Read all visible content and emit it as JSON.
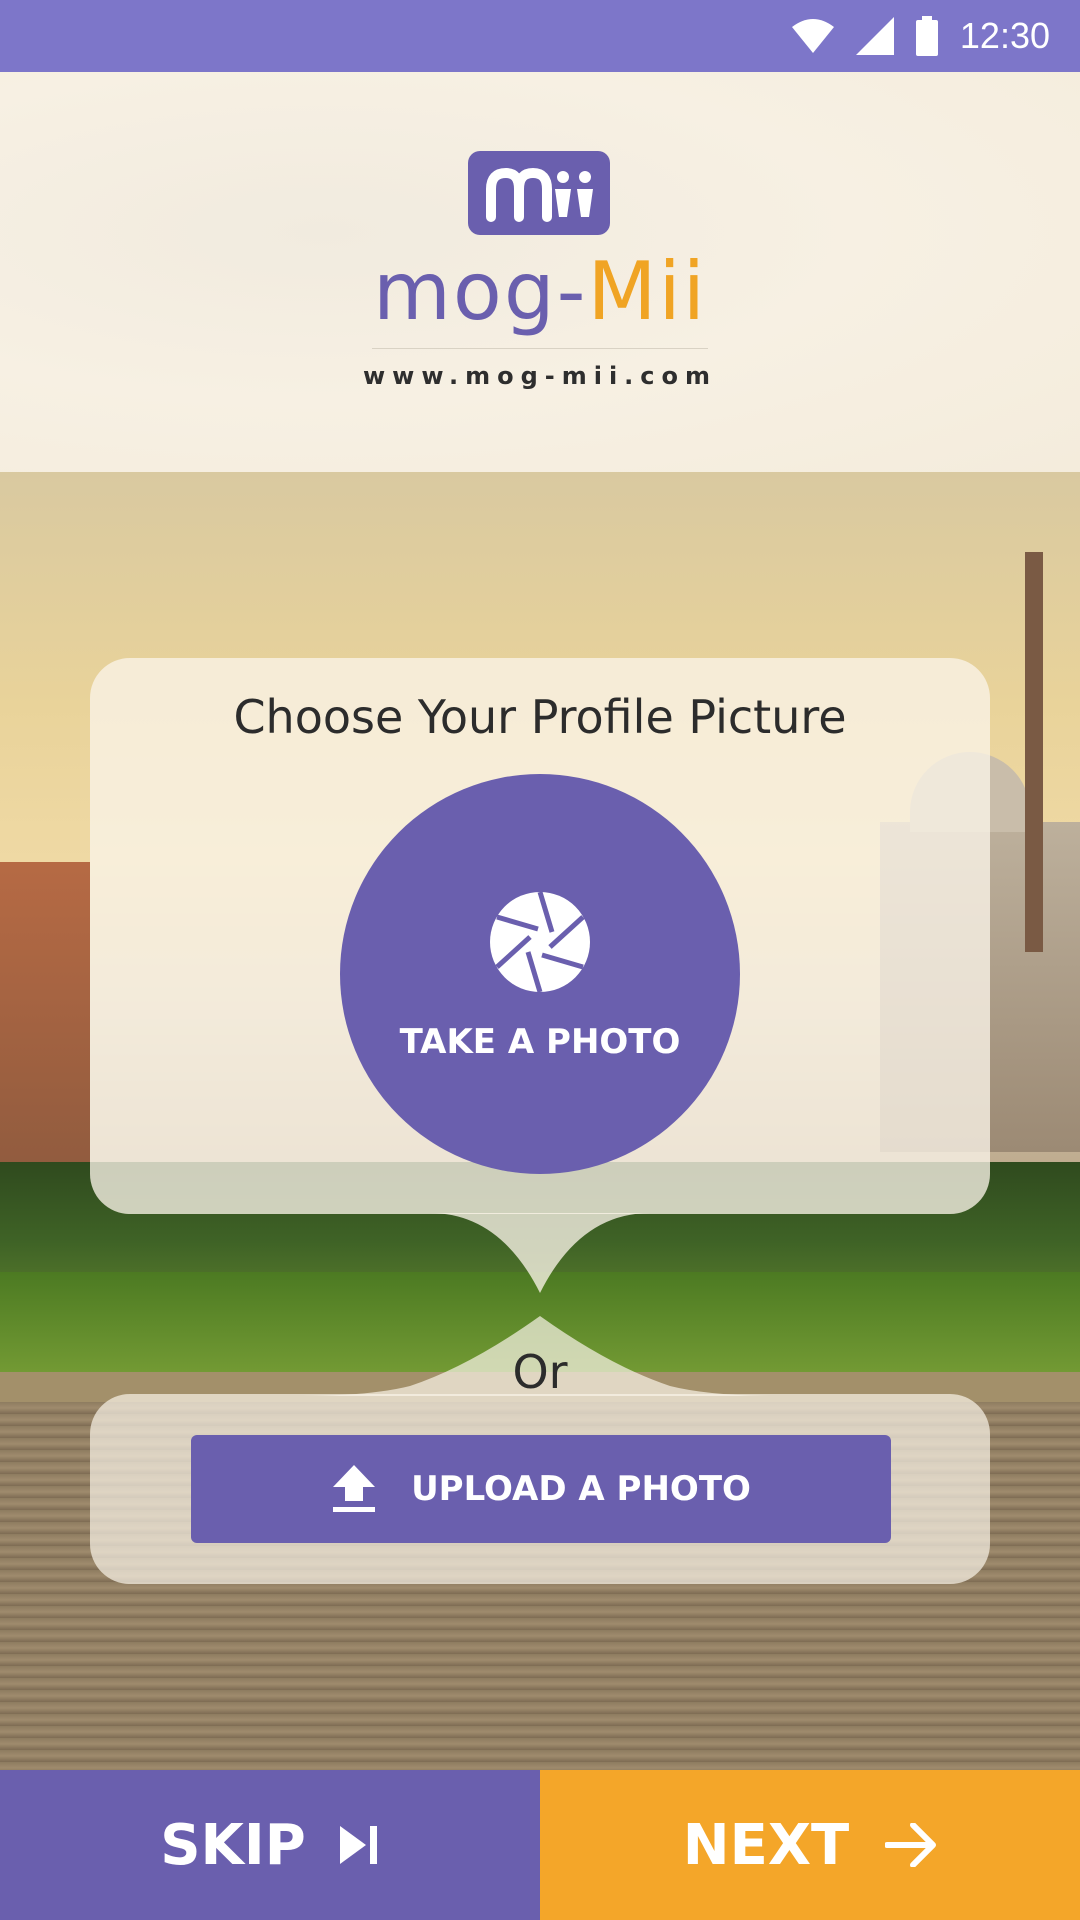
{
  "status_bar": {
    "time": "12:30",
    "icons": [
      "wifi-icon",
      "signal-icon",
      "battery-icon"
    ]
  },
  "header": {
    "logo_badge_text": "Mii",
    "logo_word_part1": "mog-",
    "logo_word_part2": "Mii",
    "website": "www.mog-mii.com"
  },
  "card": {
    "title": "Choose Your Profile Picture",
    "take_photo_label": "TAKE A PHOTO",
    "take_photo_icon": "camera-aperture-icon",
    "or_label": "Or",
    "upload_label": "UPLOAD A PHOTO",
    "upload_icon": "upload-icon"
  },
  "footer": {
    "skip_label": "SKIP",
    "skip_icon": "skip-next-icon",
    "next_label": "NEXT",
    "next_icon": "arrow-right-icon"
  },
  "colors": {
    "status_bar": "#7d76c9",
    "primary_purple": "#6a5fae",
    "accent_orange": "#f4a629",
    "background_cream": "#f7efe1"
  }
}
